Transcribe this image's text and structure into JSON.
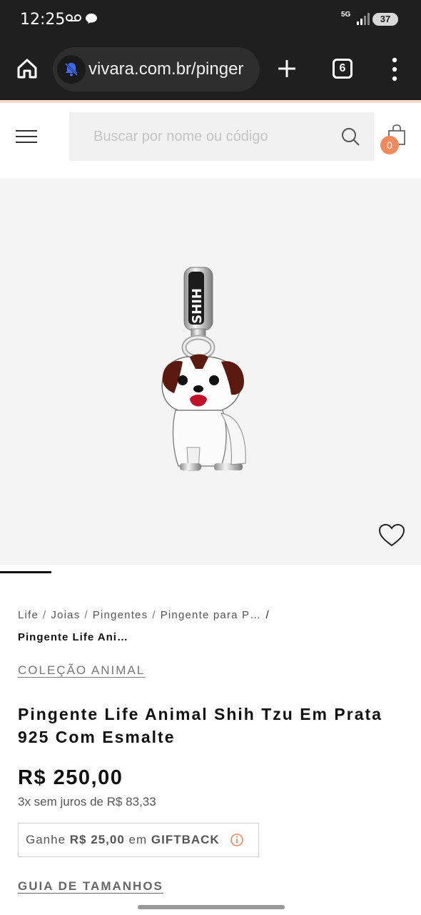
{
  "status_bar": {
    "time": "12:25",
    "network": "5G",
    "battery": "37"
  },
  "browser": {
    "url": "vivara.com.br/pinger",
    "tab_count": "6"
  },
  "header": {
    "search_placeholder": "Buscar por nome ou código",
    "cart_count": "0"
  },
  "breadcrumb": {
    "items": [
      "Life",
      "Joias",
      "Pingentes",
      "Pingente para P…"
    ],
    "current": "Pingente Life Ani…"
  },
  "product": {
    "collection": "COLEÇÃO ANIMAL",
    "title": "Pingente Life Animal Shih Tzu Em Prata 925 Com Esmalte",
    "price": "R$ 250,00",
    "installments": "3x sem juros de R$ 83,33",
    "giftback_prefix": "Ganhe",
    "giftback_amount": "R$ 25,00",
    "giftback_mid": "em",
    "giftback_label": "GIFTBACK",
    "size_guide": "GUIA DE TAMANHOS",
    "image_text": "SHIH",
    "carousel_position": 1
  },
  "colors": {
    "badge": "#ee8a5e",
    "accent_line": "#f7d9cc"
  }
}
